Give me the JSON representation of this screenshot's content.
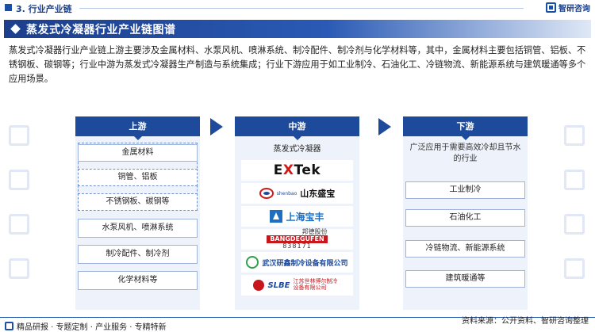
{
  "header": {
    "section_title": "3. 行业产业链",
    "brand": "智研咨询",
    "title": "蒸发式冷凝器行业产业链图谱"
  },
  "intro": "蒸发式冷凝器行业产业链上游主要涉及金属材料、水泵风机、喷淋系统、制冷配件、制冷剂与化学材料等，其中，金属材料主要包括铜管、铝板、不锈钢板、碳钢等；行业中游为蒸发式冷凝器生产制造与系统集成；行业下游应用于如工业制冷、石油化工、冷链物流、新能源系统与建筑暖通等多个应用场景。",
  "upstream": {
    "label": "上游",
    "items": [
      "金属材料",
      "铜管、铝板",
      "不锈钢板、碳钢等",
      "水泵风机、喷淋系统",
      "制冷配件、制冷剂",
      "化学材料等"
    ]
  },
  "midstream": {
    "label": "中游",
    "subtitle": "蒸发式冷凝器",
    "logos": {
      "exotek": {
        "pre": "E",
        "x": "X",
        "post": "Tek"
      },
      "shandong": {
        "en": "shenbao",
        "cn": "山东盛宝"
      },
      "shanghai": {
        "cn": "上海宝丰"
      },
      "bangde": {
        "top": "邦德股份",
        "name": "BANGDEGUFEN",
        "code": "838171"
      },
      "wuhan": {
        "cn": "武汉研鑫制冷设备有限公司"
      },
      "slbe": {
        "en": "SLBE",
        "cn": "江苏世林博尔制冷设备有限公司"
      }
    }
  },
  "downstream": {
    "label": "下游",
    "description": "广泛应用于需要高效冷却且节水的行业",
    "items": [
      "工业制冷",
      "石油化工",
      "冷链物流、新能源系统",
      "建筑暖通等"
    ]
  },
  "footer": {
    "left": "精品研报 · 专题定制 · 产业服务 · 专精特新",
    "source": "资料来源：公开资料、智研咨询整理"
  },
  "colors": {
    "primary": "#1e4a9b",
    "panel": "#eef3fb",
    "accent_red": "#c8161d"
  }
}
